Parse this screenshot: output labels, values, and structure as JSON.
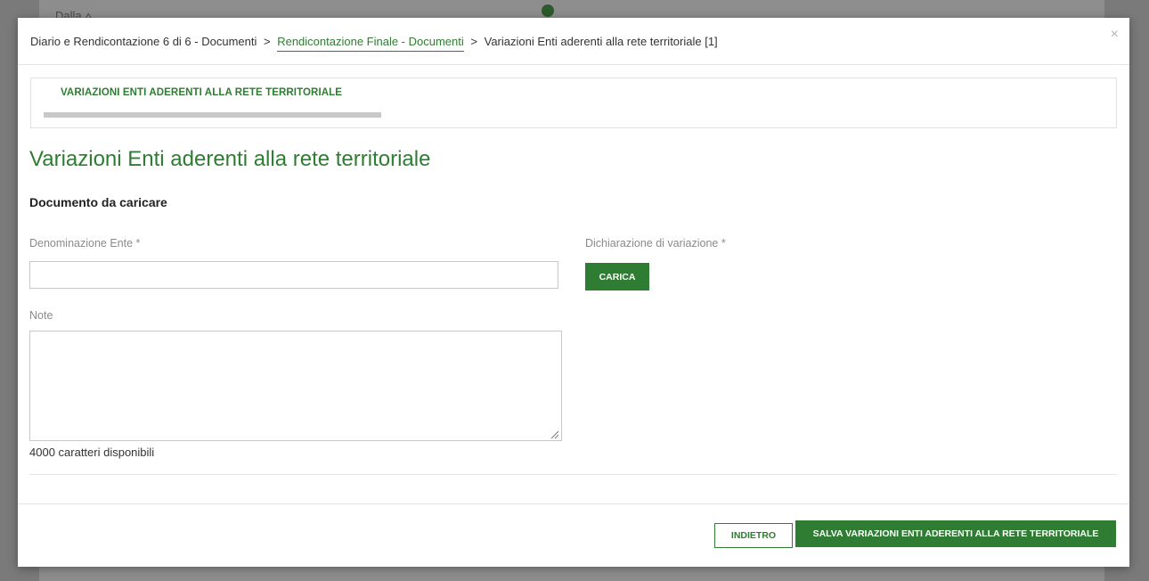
{
  "background": {
    "partial_text": "Dalla ⩟"
  },
  "breadcrumb": {
    "item1": "Diario e Rendicontazione 6 di 6 - Documenti",
    "sep": ">",
    "item2": "Rendicontazione Finale - Documenti",
    "item3": "Variazioni Enti aderenti alla rete territoriale [1]"
  },
  "close_icon": "×",
  "tab": {
    "label": "VARIAZIONI ENTI ADERENTI ALLA RETE TERRITORIALE"
  },
  "page_title": "Variazioni Enti aderenti alla rete territoriale",
  "section_title": "Documento da caricare",
  "form": {
    "denominazione_label": "Denominazione Ente *",
    "denominazione_value": "",
    "dichiarazione_label": "Dichiarazione di variazione *",
    "carica_label": "CARICA",
    "note_label": "Note",
    "note_value": "",
    "char_count": "4000 caratteri disponibili"
  },
  "footer": {
    "back_label": "INDIETRO",
    "save_label": "SALVA VARIAZIONI ENTI ADERENTI ALLA RETE TERRITORIALE"
  },
  "colors": {
    "accent": "#2e7d32",
    "overlay": "#7a7a7a"
  }
}
